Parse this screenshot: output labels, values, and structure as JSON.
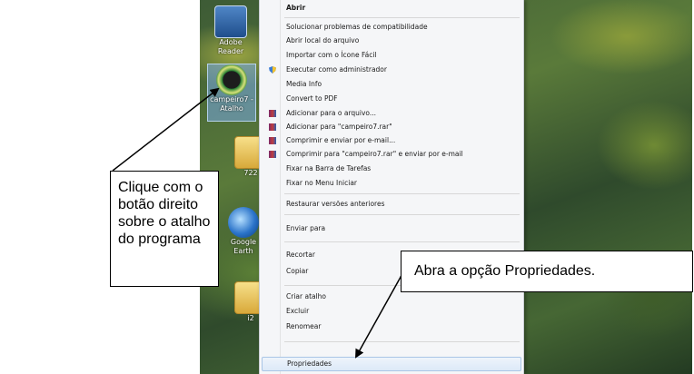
{
  "desktop": {
    "icons": [
      {
        "name": "adobe-icon",
        "label": "Adobe Reader"
      },
      {
        "name": "campeiro-icon",
        "label": "campeiro7 - Atalho"
      },
      {
        "name": "folder-icon",
        "label": "722"
      },
      {
        "name": "google-earth-icon",
        "label": "Google Earth"
      },
      {
        "name": "folder-icon-2",
        "label": "i2"
      }
    ]
  },
  "menu": {
    "items": [
      {
        "label": "Abrir",
        "bold": true
      },
      {
        "label": "Solucionar problemas de compatibilidade"
      },
      {
        "label": "Abrir local do arquivo"
      },
      {
        "label": "Importar com o Ícone Fácil"
      },
      {
        "label": "Executar como administrador",
        "icon": "shield-icon"
      },
      {
        "label": "Media Info"
      },
      {
        "label": "Convert to PDF"
      },
      {
        "label": "Adicionar para o arquivo...",
        "icon": "winrar-icon"
      },
      {
        "label": "Adicionar para \"campeiro7.rar\"",
        "icon": "winrar-icon"
      },
      {
        "label": "Comprimir e enviar por e-mail...",
        "icon": "winrar-icon"
      },
      {
        "label": "Comprimir para \"campeiro7.rar\" e enviar por e-mail",
        "icon": "winrar-icon"
      },
      {
        "label": "Fixar na Barra de Tarefas"
      },
      {
        "label": "Fixar no Menu Iniciar"
      },
      {
        "label": "Restaurar versões anteriores"
      },
      {
        "label": "Enviar para"
      },
      {
        "label": "Recortar"
      },
      {
        "label": "Copiar"
      },
      {
        "label": "Criar atalho"
      },
      {
        "label": "Excluir"
      },
      {
        "label": "Renomear"
      },
      {
        "label": "Propriedades",
        "highlighted": true
      }
    ]
  },
  "callouts": {
    "left_text": "Clique com o botão direito sobre o atalho do programa",
    "right_text": "Abra a opção Propriedades."
  },
  "colors": {
    "menu_bg": "#f5f6f8",
    "highlight": "#dce9f8",
    "arrow": "#000000"
  }
}
